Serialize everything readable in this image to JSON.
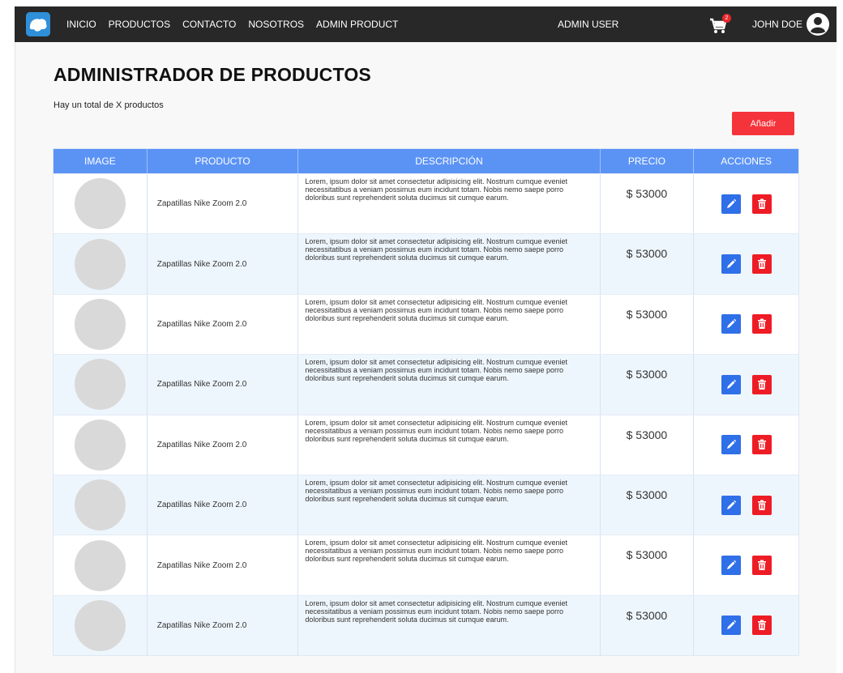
{
  "nav": {
    "links": [
      "INICIO",
      "PRODUCTOS",
      "CONTACTO",
      "NOSOTROS",
      "ADMIN PRODUCT"
    ],
    "admin_user": "ADMIN USER",
    "cart_count": "2",
    "user_name": "JOHN DOE"
  },
  "page": {
    "title": "ADMINISTRADOR DE PRODUCTOS",
    "total_text": "Hay un total de X productos",
    "add_label": "Añadir"
  },
  "table": {
    "headers": [
      "IMAGE",
      "PRODUCTO",
      "DESCRIPCIÓN",
      "PRECIO",
      "ACCIONES"
    ],
    "rows": [
      {
        "name": "Zapatillas Nike Zoom 2.0",
        "description": "Lorem, ipsum dolor sit amet consectetur adipisicing elit. Nostrum cumque eveniet necessitatibus a veniam possimus eum incidunt totam. Nobis nemo saepe porro doloribus sunt reprehenderit soluta ducimus sit cumque earum.",
        "price": "$ 53000"
      },
      {
        "name": "Zapatillas Nike Zoom 2.0",
        "description": "Lorem, ipsum dolor sit amet consectetur adipisicing elit. Nostrum cumque eveniet necessitatibus a veniam possimus eum incidunt totam. Nobis nemo saepe porro doloribus sunt reprehenderit soluta ducimus sit cumque earum.",
        "price": "$ 53000"
      },
      {
        "name": "Zapatillas Nike Zoom 2.0",
        "description": "Lorem, ipsum dolor sit amet consectetur adipisicing elit. Nostrum cumque eveniet necessitatibus a veniam possimus eum incidunt totam. Nobis nemo saepe porro doloribus sunt reprehenderit soluta ducimus sit cumque earum.",
        "price": "$ 53000"
      },
      {
        "name": "Zapatillas Nike Zoom 2.0",
        "description": "Lorem, ipsum dolor sit amet consectetur adipisicing elit. Nostrum cumque eveniet necessitatibus a veniam possimus eum incidunt totam. Nobis nemo saepe porro doloribus sunt reprehenderit soluta ducimus sit cumque earum.",
        "price": "$ 53000"
      },
      {
        "name": "Zapatillas Nike Zoom 2.0",
        "description": "Lorem, ipsum dolor sit amet consectetur adipisicing elit. Nostrum cumque eveniet necessitatibus a veniam possimus eum incidunt totam. Nobis nemo saepe porro doloribus sunt reprehenderit soluta ducimus sit cumque earum.",
        "price": "$ 53000"
      },
      {
        "name": "Zapatillas Nike Zoom 2.0",
        "description": "Lorem, ipsum dolor sit amet consectetur adipisicing elit. Nostrum cumque eveniet necessitatibus a veniam possimus eum incidunt totam. Nobis nemo saepe porro doloribus sunt reprehenderit soluta ducimus sit cumque earum.",
        "price": "$ 53000"
      },
      {
        "name": "Zapatillas Nike Zoom 2.0",
        "description": "Lorem, ipsum dolor sit amet consectetur adipisicing elit. Nostrum cumque eveniet necessitatibus a veniam possimus eum incidunt totam. Nobis nemo saepe porro doloribus sunt reprehenderit soluta ducimus sit cumque earum.",
        "price": "$ 53000"
      },
      {
        "name": "Zapatillas Nike Zoom 2.0",
        "description": "Lorem, ipsum dolor sit amet consectetur adipisicing elit. Nostrum cumque eveniet necessitatibus a veniam possimus eum incidunt totam. Nobis nemo saepe porro doloribus sunt reprehenderit soluta ducimus sit cumque earum.",
        "price": "$ 53000"
      }
    ]
  },
  "icons": {
    "logo": "brand-logo-icon",
    "cart": "shopping-cart-icon",
    "avatar": "user-avatar-icon",
    "edit": "pencil-icon",
    "delete": "trash-icon"
  },
  "colors": {
    "navbar": "#282828",
    "header_blue": "#5b93f5",
    "add_red": "#f5333b",
    "edit_blue": "#2f6fe8",
    "delete_red": "#ee1c25",
    "row_alt": "#eef6fd"
  }
}
